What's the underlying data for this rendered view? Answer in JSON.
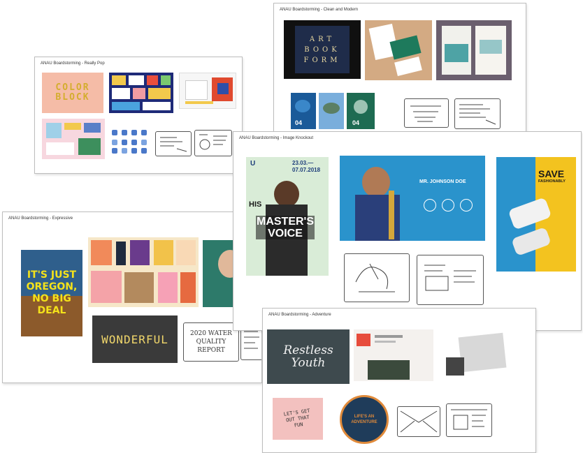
{
  "boards": {
    "color_pop": {
      "title": "ANAU Boardstorming - Really Pop"
    },
    "clean_modern": {
      "title": "ANAU Boardstorming - Clean and Modern"
    },
    "image_knockout": {
      "title": "ANAU Boardstorming - Image Knockout"
    },
    "expressive": {
      "title": "ANAU Boardstorming - Expressive"
    },
    "adventure": {
      "title": "ANAU Boardstorming - Adventure"
    }
  },
  "text": {
    "color_block": "COLOR BLOCK",
    "art_book": "ART BOOK FORM",
    "poster_date": "23.03.— 07.07.2018",
    "masters_voice": "MASTER'S VOICE",
    "his": "HIS",
    "jazz_name": "MR. JOHNSON DOE",
    "save": "SAVE",
    "fashionably": "FASHIONABLY",
    "oregon": "IT'S JUST OREGON, NO BIG DEAL",
    "wonderful": "WONDERFUL",
    "sketch_2020": "2020 WATER QUALITY REPORT",
    "restless": "Restless",
    "youth": "Youth",
    "adventure_badge": "LIFE'S AN ADVENTURE",
    "lets_get_out": "LET'S GET OUT THAT FUN",
    "number_04": "04"
  },
  "colors": {
    "board_border": "#bdbdbd",
    "peach": "#f5bca7",
    "navy": "#1f2c4a",
    "jazz_blue": "#2a93cc",
    "shoe_yellow": "#f3c31f",
    "oregon_yellow": "#f4e21a",
    "wonderful_bg": "#3a3a3a"
  }
}
